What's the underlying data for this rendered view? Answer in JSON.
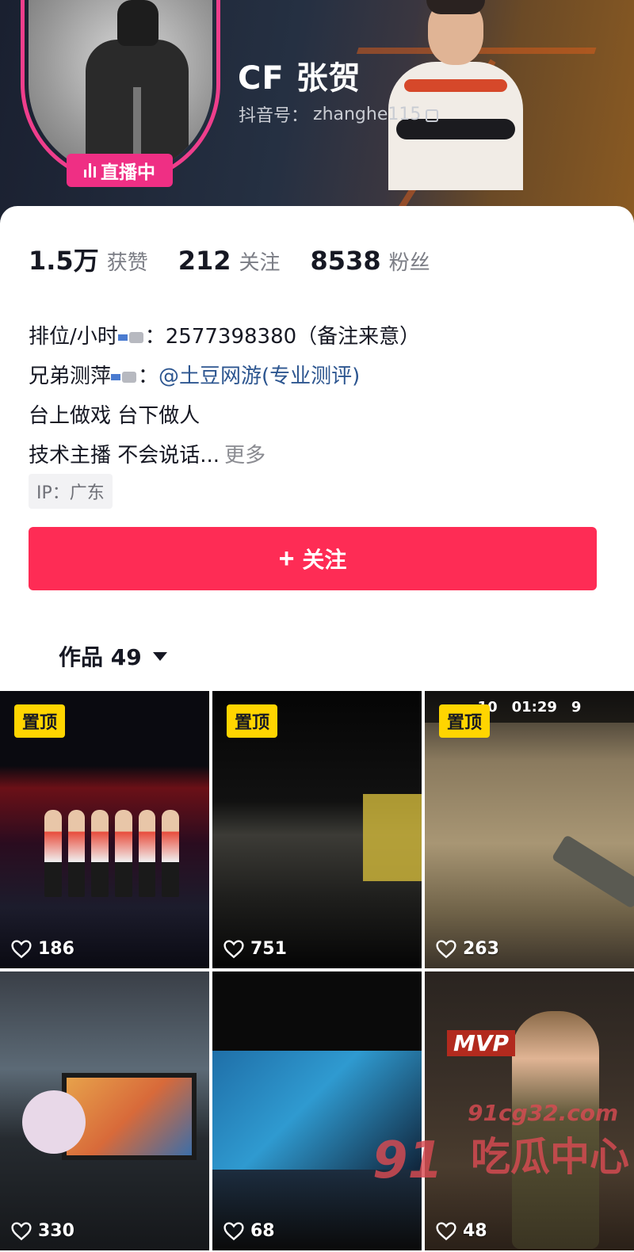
{
  "profile": {
    "name": "CF 张贺",
    "douyin_id_label": "抖音号：",
    "douyin_id": "zhanghe115",
    "live_badge": "直播中"
  },
  "stats": [
    {
      "value": "1.5万",
      "label": "获赞"
    },
    {
      "value": "212",
      "label": "关注"
    },
    {
      "value": "8538",
      "label": "粉丝"
    }
  ],
  "bio": {
    "line1_prefix": "排位/小时",
    "line1_value": "：2577398380（备注来意）",
    "line2_prefix": "兄弟测萍",
    "line2_colon": "：",
    "line2_link": "@土豆网游(专业测评)",
    "line3": "台上做戏 台下做人",
    "line4": "技术主播 不会说话...",
    "more": "更多"
  },
  "ip_tag": "IP：广东",
  "follow_button": "关注",
  "works_tab": "作品 49",
  "videos": [
    {
      "pinned": true,
      "pin_label": "置顶",
      "likes": "186"
    },
    {
      "pinned": true,
      "pin_label": "置顶",
      "likes": "751"
    },
    {
      "pinned": true,
      "pin_label": "置顶",
      "likes": "263",
      "hud_time": "01:29",
      "hud_round": "10",
      "hud_score": "9"
    },
    {
      "pinned": false,
      "likes": "330"
    },
    {
      "pinned": false,
      "likes": "68"
    },
    {
      "pinned": false,
      "likes": "48",
      "badge": "MVP"
    }
  ],
  "watermark": {
    "number": "91",
    "site": "91cg32.com",
    "text": "吃瓜中心"
  },
  "colors": {
    "accent_red": "#fe2c55",
    "live_pink": "#ef2f84",
    "pin_yellow": "#ffd500",
    "link_blue": "#2d5690"
  }
}
